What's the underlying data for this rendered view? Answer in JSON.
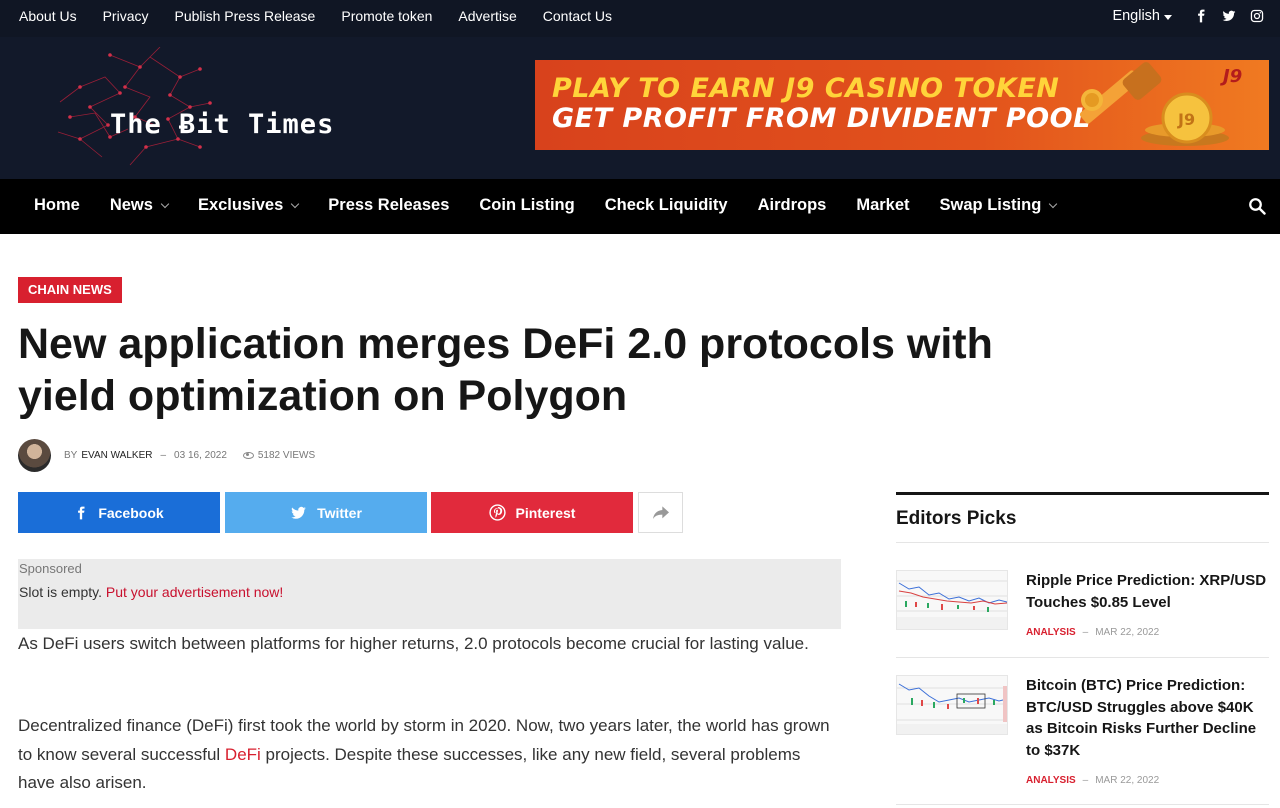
{
  "topbar": {
    "links": [
      "About Us",
      "Privacy",
      "Publish Press Release",
      "Promote token",
      "Advertise",
      "Contact Us"
    ],
    "language": "English",
    "social_icons": [
      "facebook-icon",
      "twitter-icon",
      "instagram-icon"
    ]
  },
  "header": {
    "logo_text": "The Ƀit Times",
    "banner": {
      "line1": "PLAY TO EARN J9 CASINO TOKEN",
      "line2": "GET PROFIT FROM DIVIDENT POOL",
      "badge": "J9"
    }
  },
  "nav": {
    "items": [
      {
        "label": "Home",
        "dropdown": false
      },
      {
        "label": "News",
        "dropdown": true
      },
      {
        "label": "Exclusives",
        "dropdown": true
      },
      {
        "label": "Press Releases",
        "dropdown": false
      },
      {
        "label": "Coin Listing",
        "dropdown": false
      },
      {
        "label": "Check Liquidity",
        "dropdown": false
      },
      {
        "label": "Airdrops",
        "dropdown": false
      },
      {
        "label": "Market",
        "dropdown": false
      },
      {
        "label": "Swap Listing",
        "dropdown": true
      }
    ]
  },
  "article": {
    "category": "CHAIN NEWS",
    "title": "New application merges DeFi 2.0 protocols with yield optimization on Polygon",
    "meta": {
      "by": "BY",
      "author": "EVAN WALKER",
      "date": "03 16, 2022",
      "views": "5182 VIEWS"
    },
    "share": {
      "facebook": "Facebook",
      "twitter": "Twitter",
      "pinterest": "Pinterest"
    },
    "sponsored": {
      "label": "Sponsored",
      "message": "Slot is empty. ",
      "link": "Put your advertisement now!"
    },
    "p1": "As DeFi users switch between platforms for higher returns, 2.0 protocols become crucial for lasting value.",
    "p2_before": "Decentralized finance (DeFi) first took the world by storm in 2020. Now, two years later, the world has grown to know several successful ",
    "p2_link": "DeFi",
    "p2_after": " projects. Despite these successes, like any new field, several problems have also arisen."
  },
  "sidebar": {
    "title": "Editors Picks",
    "picks": [
      {
        "title": "Ripple Price Prediction: XRP/USD Touches $0.85 Level",
        "category": "ANALYSIS",
        "date": "MAR 22, 2022"
      },
      {
        "title": "Bitcoin (BTC) Price Prediction: BTC/USD Struggles above $40K as Bitcoin Risks Further Decline to $37K",
        "category": "ANALYSIS",
        "date": "MAR 22, 2022"
      }
    ]
  },
  "colors": {
    "accent": "#d8202f",
    "topbar_bg": "#101624",
    "nav_bg": "#000000",
    "facebook": "#1a6ed8",
    "twitter": "#55acee",
    "pinterest": "#e12a3c"
  }
}
